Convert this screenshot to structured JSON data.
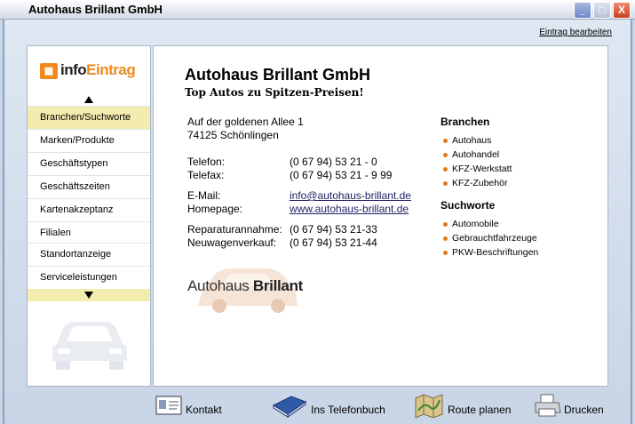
{
  "window": {
    "title": "Autohaus Brillant GmbH",
    "minimize": "_",
    "maximize": "□",
    "close": "X"
  },
  "header": {
    "edit_link": "Eintrag bearbeiten"
  },
  "logo": {
    "part1": "info",
    "part2": "Eintrag"
  },
  "sidebar": {
    "items": [
      {
        "label": "Branchen/Suchworte",
        "active": true
      },
      {
        "label": "Marken/Produkte"
      },
      {
        "label": "Geschäftstypen"
      },
      {
        "label": "Geschäftszeiten"
      },
      {
        "label": "Kartenakzeptanz"
      },
      {
        "label": "Filialen"
      },
      {
        "label": "Standortanzeige"
      },
      {
        "label": "Serviceleistungen"
      }
    ]
  },
  "main": {
    "company": "Autohaus Brillant GmbH",
    "slogan": "Top Autos zu Spitzen-Preisen!",
    "address_line1": "Auf der goldenen Allee 1",
    "address_line2": "74125 Schönlingen",
    "contacts": [
      {
        "label": "Telefon:",
        "value": "(0 67 94) 53 21 - 0"
      },
      {
        "label": "Telefax:",
        "value": "(0 67 94) 53 21 - 9 99"
      },
      {
        "label": "E-Mail:",
        "value": "info@autohaus-brillant.de",
        "link": true
      },
      {
        "label": "Homepage:",
        "value": "www.autohaus-brillant.de",
        "link": true
      },
      {
        "label": "Reparaturannahme:",
        "value": "(0 67 94) 53 21-33"
      },
      {
        "label": "Neuwagenverkauf:",
        "value": "(0 67 94) 53 21-44"
      }
    ],
    "branchen_title": "Branchen",
    "branchen": [
      "Autohaus",
      "Autohandel",
      "KFZ-Werkstatt",
      "KFZ-Zubehör"
    ],
    "suchworte_title": "Suchworte",
    "suchworte": [
      "Automobile",
      "Gebrauchtfahrzeuge",
      "PKW-Beschriftungen"
    ],
    "brand_logo_text1": "Autohaus",
    "brand_logo_text2": "Brillant"
  },
  "toolbar": {
    "contact": "Kontakt",
    "phonebook": "Ins Telefonbuch",
    "route": "Route planen",
    "print": "Drucken"
  },
  "colors": {
    "accent": "#f08a1c",
    "highlight": "#f4ecae",
    "bullet": "#e07a1a"
  }
}
